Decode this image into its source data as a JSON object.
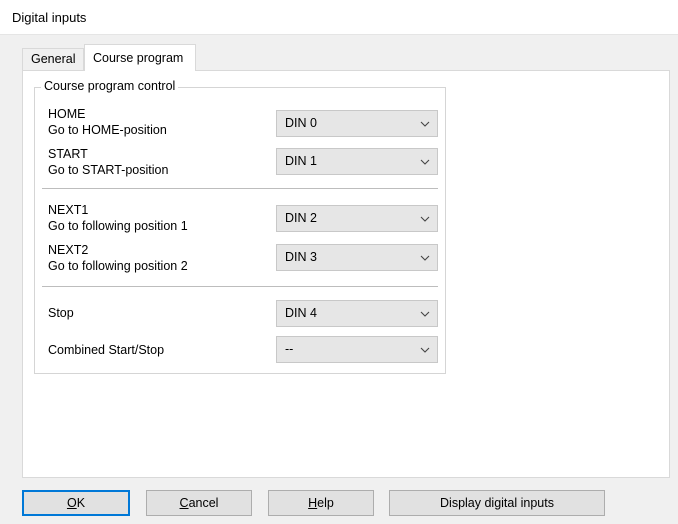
{
  "window": {
    "title": "Digital inputs"
  },
  "tabs": [
    {
      "label": "General"
    },
    {
      "label": "Course program"
    }
  ],
  "group": {
    "title": "Course program control"
  },
  "rows": [
    {
      "label1": "HOME",
      "label2": "Go to HOME-position",
      "value": "DIN 0"
    },
    {
      "label1": "START",
      "label2": "Go to START-position",
      "value": "DIN 1"
    },
    {
      "label1": "NEXT1",
      "label2": "Go to following position 1",
      "value": "DIN 2"
    },
    {
      "label1": "NEXT2",
      "label2": "Go to following position 2",
      "value": "DIN 3"
    },
    {
      "label1": "Stop",
      "value": "DIN 4"
    },
    {
      "label1": "Combined Start/Stop",
      "value": "--"
    }
  ],
  "buttons": {
    "ok": {
      "mnemonic": "O",
      "rest": "K"
    },
    "cancel": {
      "mnemonic": "C",
      "rest": "ancel"
    },
    "help": {
      "mnemonic": "H",
      "rest": "elp"
    },
    "display": "Display digital inputs"
  },
  "icons": {
    "dropdown": "chevron-down-icon"
  }
}
